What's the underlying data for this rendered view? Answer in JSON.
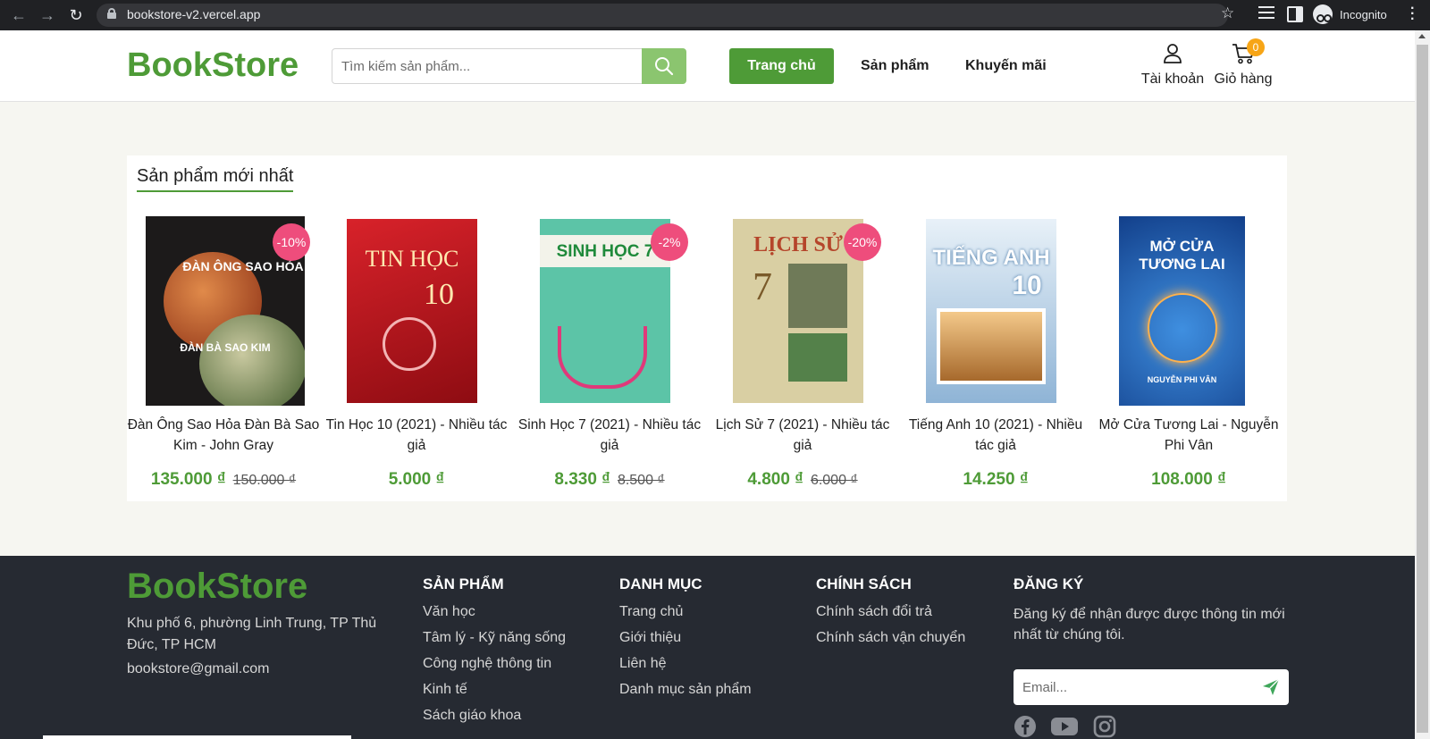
{
  "browser": {
    "url": "bookstore-v2.vercel.app",
    "profile_label": "Incognito"
  },
  "header": {
    "logo": "BookStore",
    "search_placeholder": "Tìm kiếm sản phẩm...",
    "nav": {
      "home": "Trang chủ",
      "products": "Sản phẩm",
      "promotions": "Khuyến mãi"
    },
    "account_label": "Tài khoản",
    "cart_label": "Giỏ hàng",
    "cart_count": "0"
  },
  "section": {
    "title": "Sản phẩm mới nhất",
    "products": [
      {
        "name": "Đàn Ông Sao Hỏa Đàn Bà Sao Kim - John Gray",
        "price": "135.000 ₫",
        "old_price": "150.000 ₫",
        "discount": "-10%"
      },
      {
        "name": "Tin Học 10 (2021) - Nhiều tác giả",
        "price": "5.000 ₫",
        "old_price": "",
        "discount": ""
      },
      {
        "name": "Sinh Học 7 (2021) - Nhiều tác giả",
        "price": "8.330 ₫",
        "old_price": "8.500 ₫",
        "discount": "-2%"
      },
      {
        "name": "Lịch Sử 7 (2021) - Nhiều tác giả",
        "price": "4.800 ₫",
        "old_price": "6.000 ₫",
        "discount": "-20%"
      },
      {
        "name": "Tiếng Anh 10 (2021) - Nhiều tác giả",
        "price": "14.250 ₫",
        "old_price": "",
        "discount": ""
      },
      {
        "name": "Mở Cửa Tương Lai - Nguyễn Phi Vân",
        "price": "108.000 ₫",
        "old_price": "",
        "discount": ""
      }
    ],
    "covers": [
      {
        "title": "ĐÀN ÔNG SAO HỎA",
        "subtitle": "ĐÀN BÀ SAO KIM",
        "color": "#1c1a1a"
      },
      {
        "title": "TIN HỌC",
        "subtitle": "10",
        "color": "#c8141b"
      },
      {
        "title": "SINH HỌC 7",
        "subtitle": "",
        "color": "#5cc4a7"
      },
      {
        "title": "LỊCH SỬ",
        "subtitle": "7",
        "color": "#d9cfa3"
      },
      {
        "title": "TIẾNG ANH",
        "subtitle": "10",
        "color": "#cfe2f2"
      },
      {
        "title": "MỞ CỬA TƯƠNG LAI",
        "subtitle": "NGUYỄN PHI VÂN",
        "color": "#1b5fb8"
      }
    ]
  },
  "footer": {
    "logo": "BookStore",
    "address": "Khu phố 6, phường Linh Trung, TP Thủ Đức, TP HCM",
    "email": "bookstore@gmail.com",
    "columns": [
      {
        "heading": "SẢN PHẨM",
        "links": [
          "Văn học",
          "Tâm lý - Kỹ năng sống",
          "Công nghệ thông tin",
          "Kinh tế",
          "Sách giáo khoa"
        ]
      },
      {
        "heading": "DANH MỤC",
        "links": [
          "Trang chủ",
          "Giới thiệu",
          "Liên hệ",
          "Danh mục sản phẩm"
        ]
      },
      {
        "heading": "CHÍNH SÁCH",
        "links": [
          "Chính sách đổi trả",
          "Chính sách vận chuyển"
        ]
      }
    ],
    "subscribe": {
      "heading": "ĐĂNG KÝ",
      "text": "Đăng ký để nhận được được thông tin mới nhất từ chúng tôi.",
      "placeholder": "Email..."
    },
    "socials": [
      "facebook-icon",
      "youtube-icon",
      "instagram-icon"
    ]
  },
  "colors": {
    "brand_green": "#4e9b37",
    "discount_pink": "#ee4d7c",
    "cart_badge": "#f7a516",
    "footer_bg": "#262a32"
  }
}
